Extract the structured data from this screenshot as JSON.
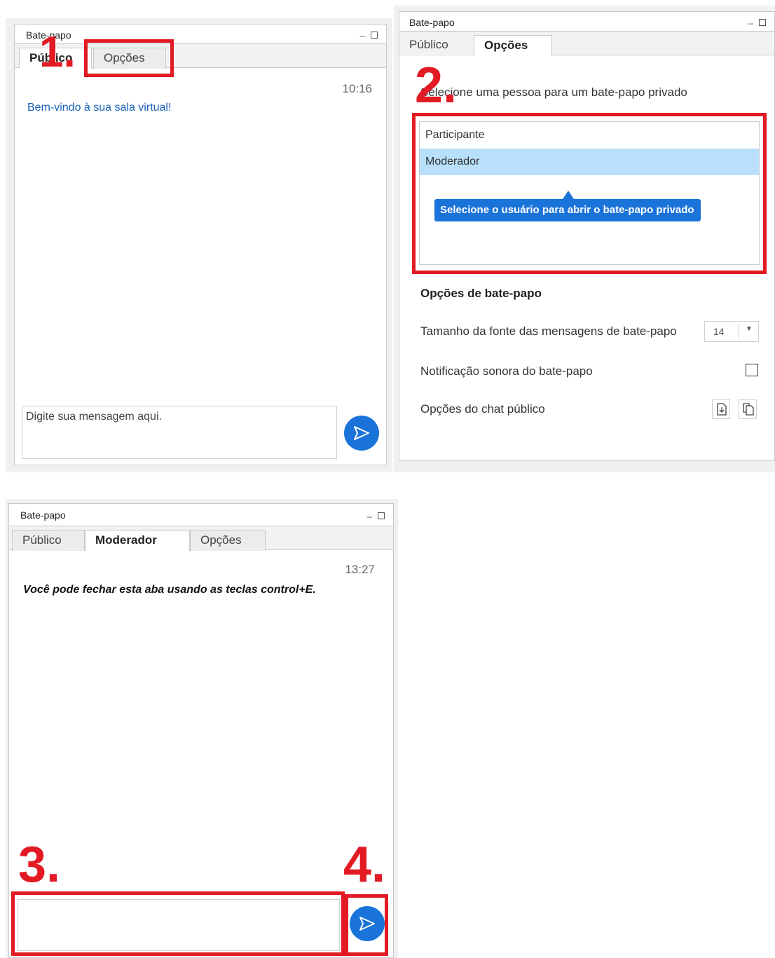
{
  "panel_public": {
    "title": "Bate-papo",
    "tabs": [
      "Público",
      "Opções"
    ],
    "timestamp": "10:16",
    "welcome": "Bem-vindo à sua sala virtual!",
    "input_placeholder": "Digite sua mensagem aqui."
  },
  "panel_options": {
    "title": "Bate-papo",
    "tabs": [
      "Público",
      "Opções"
    ],
    "select_hint": "Selecione uma pessoa para um bate-papo privado",
    "participants": [
      "Participante",
      "Moderador"
    ],
    "tooltip": "Selecione o usuário para abrir o bate-papo privado",
    "section_heading": "Opções de bate-papo",
    "font_size_label": "Tamanho da fonte das mensagens de bate-papo",
    "font_size_value": "14",
    "sound_label": "Notificação sonora do bate-papo",
    "sound_enabled": false,
    "public_chat_label": "Opções do chat público"
  },
  "panel_private": {
    "title": "Bate-papo",
    "tabs": [
      "Público",
      "Moderador",
      "Opções"
    ],
    "timestamp": "13:27",
    "system_message": "Você pode fechar esta aba usando as teclas control+E.",
    "input_value": ""
  },
  "annotations": [
    "1.",
    "2.",
    "3.",
    "4."
  ],
  "colors": {
    "accent": "#1a73d9",
    "highlight_box": "#e21a24",
    "selected_row": "#b8e0fb",
    "welcome_text": "#1a63b8"
  }
}
